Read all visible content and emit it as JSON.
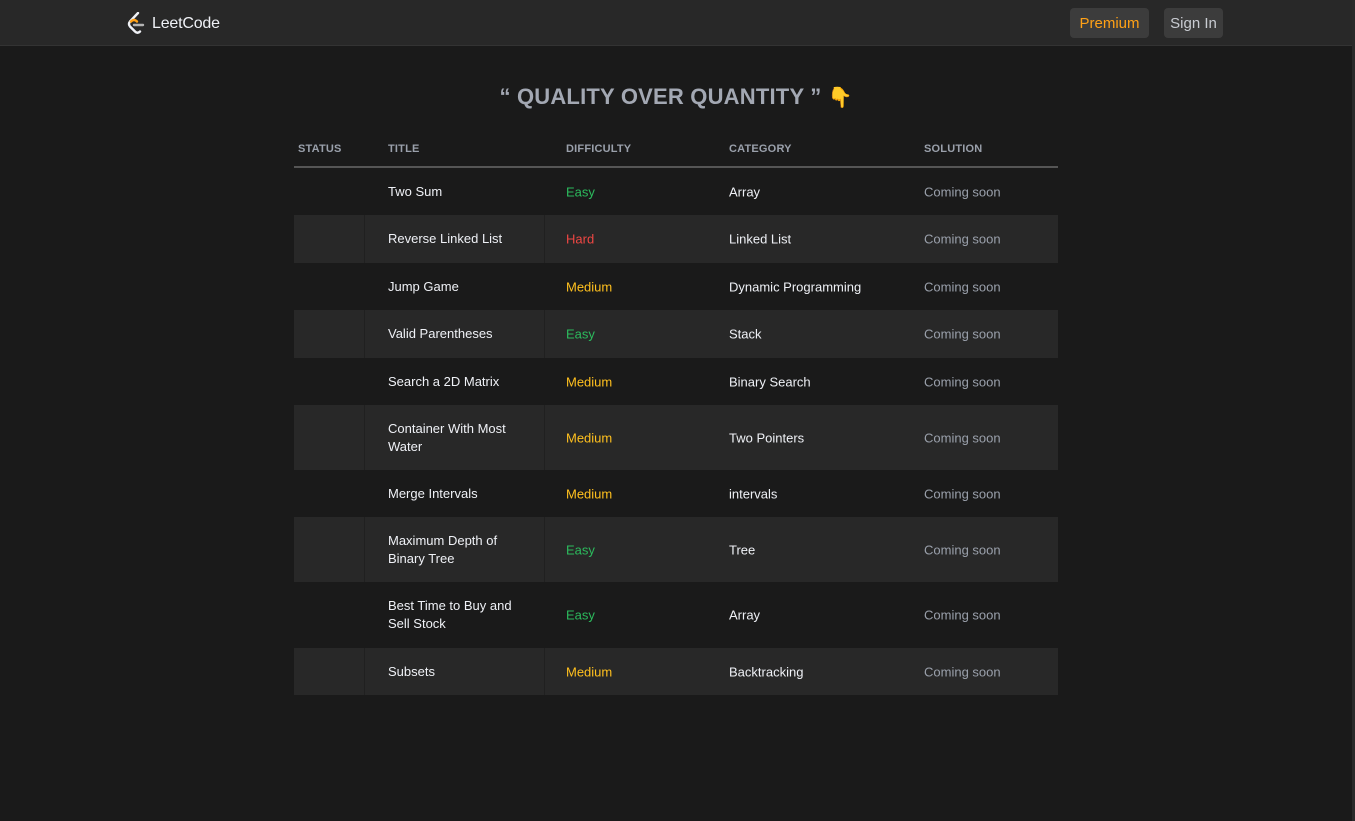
{
  "nav": {
    "logo_text": "LeetCode",
    "premium_label": "Premium",
    "signin_label": "Sign In"
  },
  "heading": {
    "text": "“ QUALITY OVER QUANTITY ”",
    "emoji": "👇"
  },
  "table": {
    "headers": [
      "STATUS",
      "TITLE",
      "DIFFICULTY",
      "CATEGORY",
      "SOLUTION"
    ],
    "rows": [
      {
        "title": "Two Sum",
        "difficulty": "Easy",
        "category": "Array",
        "solution": "Coming soon"
      },
      {
        "title": "Reverse Linked List",
        "difficulty": "Hard",
        "category": "Linked List",
        "solution": "Coming soon"
      },
      {
        "title": "Jump Game",
        "difficulty": "Medium",
        "category": "Dynamic Programming",
        "solution": "Coming soon"
      },
      {
        "title": "Valid Parentheses",
        "difficulty": "Easy",
        "category": "Stack",
        "solution": "Coming soon"
      },
      {
        "title": "Search a 2D Matrix",
        "difficulty": "Medium",
        "category": "Binary Search",
        "solution": "Coming soon"
      },
      {
        "title": "Container With Most Water",
        "difficulty": "Medium",
        "category": "Two Pointers",
        "solution": "Coming soon"
      },
      {
        "title": "Merge Intervals",
        "difficulty": "Medium",
        "category": "intervals",
        "solution": "Coming soon"
      },
      {
        "title": "Maximum Depth of Binary Tree",
        "difficulty": "Easy",
        "category": "Tree",
        "solution": "Coming soon"
      },
      {
        "title": "Best Time to Buy and Sell Stock",
        "difficulty": "Easy",
        "category": "Array",
        "solution": "Coming soon"
      },
      {
        "title": "Subsets",
        "difficulty": "Medium",
        "category": "Backtracking",
        "solution": "Coming soon"
      }
    ]
  },
  "colors": {
    "easy": "#2cbb5d",
    "medium": "#ffc01e",
    "hard": "#ef4743",
    "accent": "#ffa116"
  }
}
